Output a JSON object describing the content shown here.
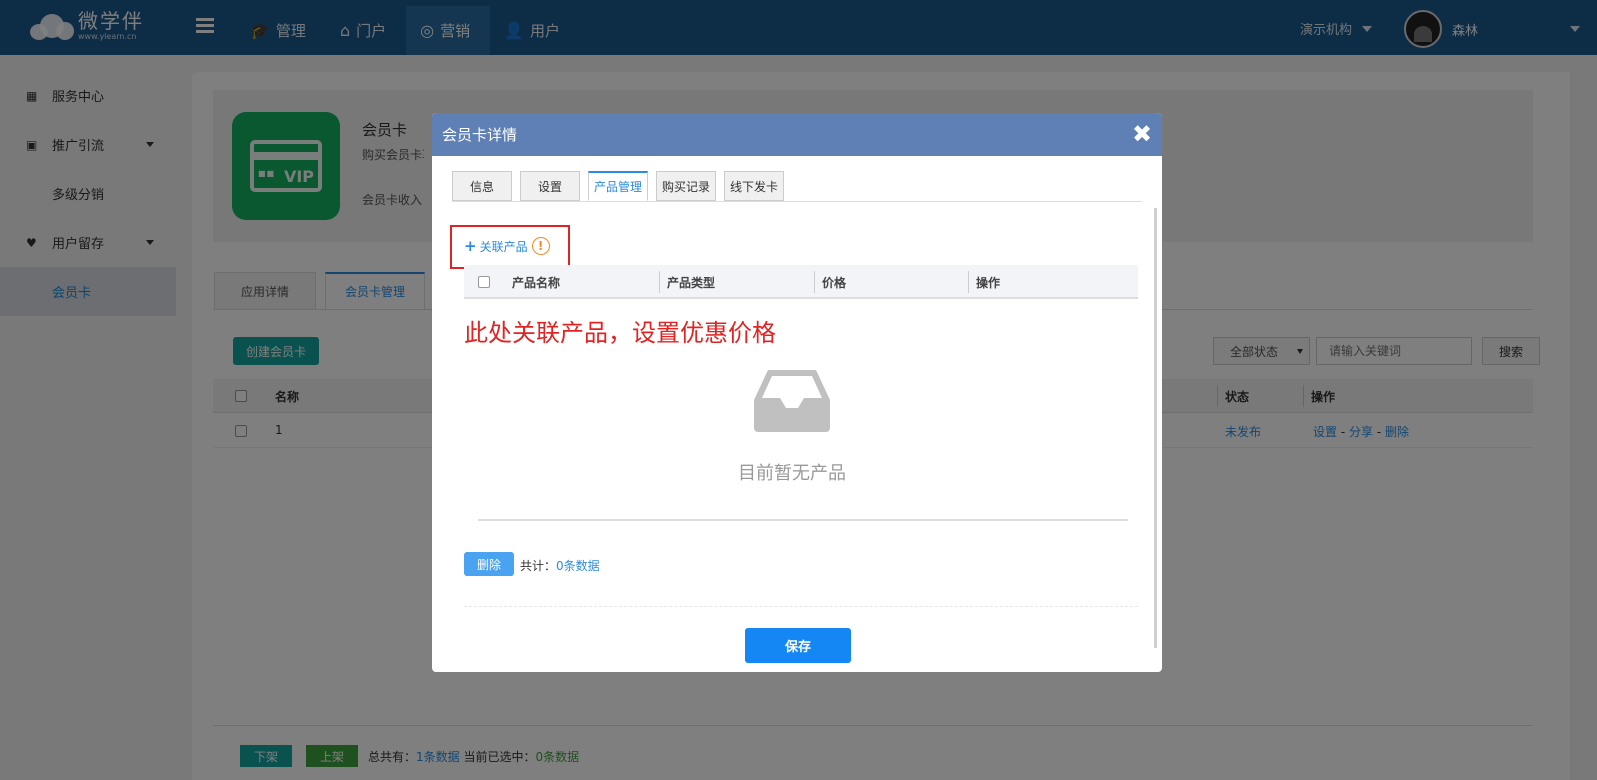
{
  "header": {
    "logo_main": "微学伴",
    "logo_sub": "www.ylearn.cn",
    "nav": [
      {
        "label": "管理",
        "icon": "graduation-cap-icon"
      },
      {
        "label": "门户",
        "icon": "home-icon"
      },
      {
        "label": "营销",
        "icon": "target-icon"
      },
      {
        "label": "用户",
        "icon": "user-add-icon"
      }
    ],
    "org": "演示机构",
    "user_name": "森林"
  },
  "sidebar": {
    "items": [
      {
        "label": "服务中心"
      },
      {
        "label": "推广引流"
      },
      {
        "label": "多级分销"
      },
      {
        "label": "用户留存"
      },
      {
        "label": "会员卡"
      }
    ]
  },
  "app": {
    "name": "会员卡",
    "desc": "购买会员卡享受优惠",
    "income": "会员卡收入"
  },
  "page_tabs": [
    "应用详情",
    "会员卡管理"
  ],
  "toolbar": {
    "create_label": "创建会员卡",
    "status_select": "全部状态",
    "keyword_placeholder": "请输入关键词",
    "search_label": "搜索"
  },
  "table": {
    "headers": {
      "name": "名称",
      "status": "状态",
      "ops": "操作"
    },
    "rows": [
      {
        "name": "1",
        "status": "未发布",
        "op1": "设置",
        "op2": "分享",
        "op3": "删除"
      }
    ]
  },
  "footer": {
    "down_label": "下架",
    "up_label": "上架",
    "total_prefix": "总共有：",
    "total_value": "1条数据",
    "selected_prefix": "当前已选中：",
    "selected_value": "0条数据"
  },
  "modal": {
    "title": "会员卡详情",
    "tabs": [
      "信息",
      "设置",
      "产品管理",
      "购买记录",
      "线下发卡"
    ],
    "link_product": "关联产品",
    "table_headers": [
      "产品名称",
      "产品类型",
      "价格",
      "操作"
    ],
    "annotation": "此处关联产品，设置优惠价格",
    "empty_text": "目前暂无产品",
    "delete_label": "删除",
    "total_prefix": "共计：",
    "total_value": "0条数据",
    "save_label": "保存"
  },
  "colors": {
    "topbar": "#1b5b8e",
    "modal_header": "#5f80b4",
    "accent": "#2a8ce0",
    "annotation": "#e02424",
    "app_icon": "#13b060"
  }
}
